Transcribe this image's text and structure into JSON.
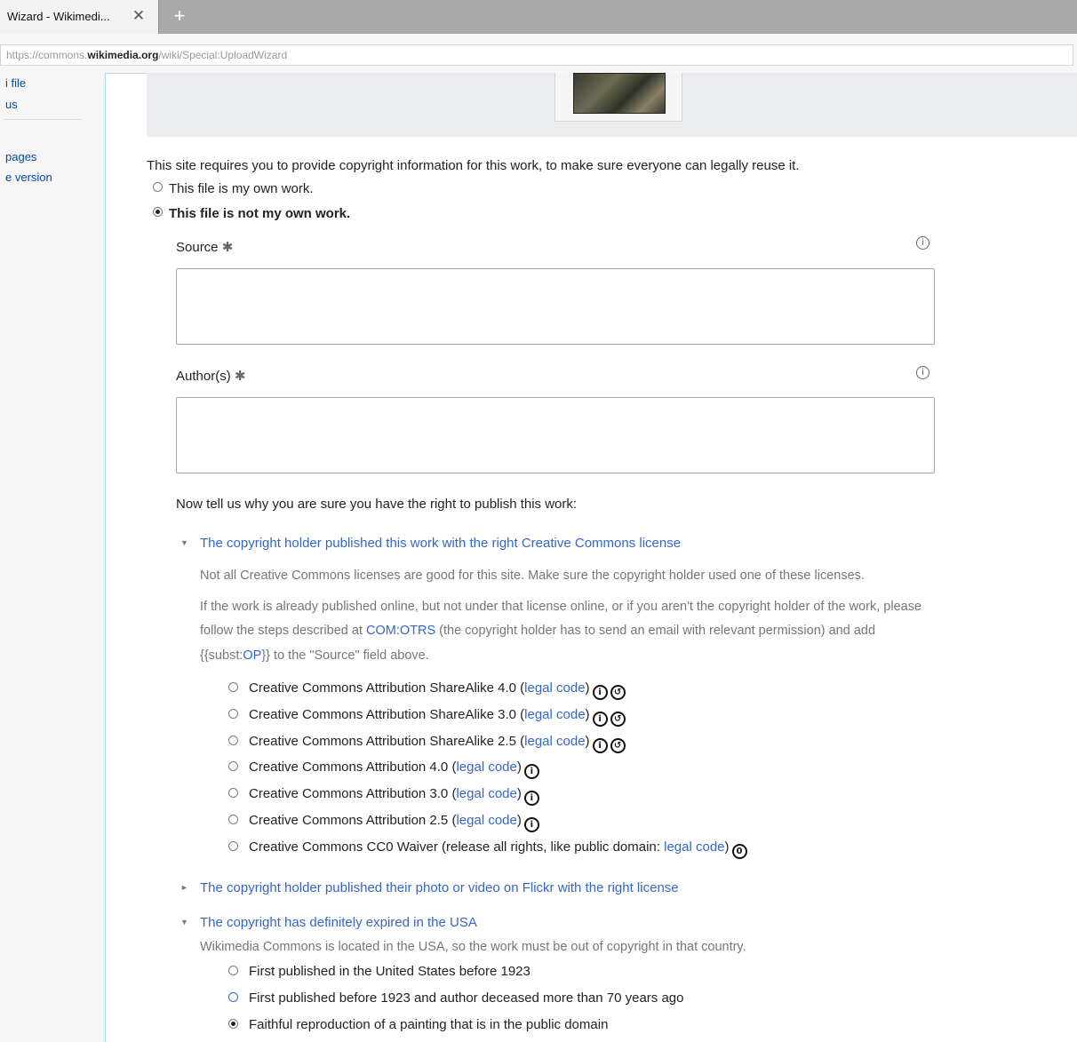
{
  "browser": {
    "tab_title": "Wizard - Wikimedi...",
    "tab_close": "✕",
    "new_tab": "+",
    "url_prefix": "https://commons.",
    "url_domain": "wikimedia.org",
    "url_path": "/wiki/Special:UploadWizard"
  },
  "sidebar": {
    "items": [
      "i file",
      "us",
      "pages",
      "e version"
    ]
  },
  "form": {
    "intro": "This site requires you to provide copyright information for this work, to make sure everyone can legally reuse it.",
    "own_work_label": "This file is my own work.",
    "not_own_work_label": "This file is not my own work.",
    "source_label": "Source",
    "author_label": "Author(s)",
    "required_marker": "✱",
    "info_glyph": "i",
    "why_prompt": "Now tell us why you are sure you have the right to publish this work:"
  },
  "sections": {
    "cc": {
      "arrow": "▼",
      "title": "The copyright holder published this work with the right Creative Commons license",
      "note1": "Not all Creative Commons licenses are good for this site. Make sure the copyright holder used one of these licenses.",
      "note2_line1": "If the work is already published online, but not under that license online, or if you aren't the copyright holder of the work, please",
      "note2_line2_a": "follow the steps described at ",
      "note2_link": "COM:OTRS",
      "note2_line2_b": " (the copyright holder has to send an email with relevant permission) and add",
      "note2_line3_a": "{{subst:",
      "note2_line3_link": "OP",
      "note2_line3_b": "}} to the \"Source\" field above."
    },
    "flickr": {
      "arrow": "►",
      "title": "The copyright holder published their photo or video on Flickr with the right license"
    },
    "expired": {
      "arrow": "▼",
      "title": "The copyright has definitely expired in the USA",
      "note": "Wikimedia Commons is located in the USA, so the work must be out of copyright in that country.",
      "options": [
        "First published in the United States before 1923",
        "First published before 1923 and author deceased more than 70 years ago",
        "Faithful reproduction of a painting that is in the public domain"
      ]
    }
  },
  "licenses": [
    {
      "name": "Creative Commons Attribution ShareAlike 4.0",
      "link": "legal code",
      "icons": [
        "cc-by-icon",
        "cc-sa-icon"
      ]
    },
    {
      "name": "Creative Commons Attribution ShareAlike 3.0",
      "link": "legal code",
      "icons": [
        "cc-by-icon",
        "cc-sa-icon"
      ]
    },
    {
      "name": "Creative Commons Attribution ShareAlike 2.5",
      "link": "legal code",
      "icons": [
        "cc-by-icon",
        "cc-sa-icon"
      ]
    },
    {
      "name": "Creative Commons Attribution 4.0",
      "link": "legal code",
      "icons": [
        "cc-by-icon"
      ]
    },
    {
      "name": "Creative Commons Attribution 3.0",
      "link": "legal code",
      "icons": [
        "cc-by-icon"
      ]
    },
    {
      "name": "Creative Commons Attribution 2.5",
      "link": "legal code",
      "icons": [
        "cc-by-icon"
      ]
    },
    {
      "name": "Creative Commons CC0 Waiver (release all rights, like public domain:",
      "link": "legal code",
      "icons": [
        "cc-zero-icon"
      ]
    }
  ],
  "colors": {
    "link": "#3366cc",
    "sidebar_border": "#a7d7f9",
    "preview_bg": "#eaecf0"
  }
}
